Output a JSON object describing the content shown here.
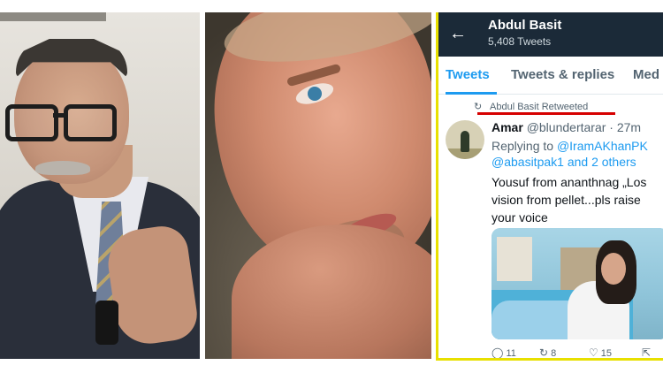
{
  "profile": {
    "name": "Abdul Basit",
    "tweet_count": "5,408 Tweets"
  },
  "tabs": [
    "Tweets",
    "Tweets & replies",
    "Med"
  ],
  "retweet_banner": "Abdul Basit Retweeted",
  "tweet": {
    "author_name": "Amar",
    "author_handle": "@blundertarar",
    "time": "27m",
    "reply_prefix": "Replying to",
    "reply_mention_1": "@IramAKhanPK",
    "reply_line_2_mention": "@abasitpak1",
    "reply_line_2_rest": "and 2 others",
    "text": "Yousuf from ananthnag „Los\nvision from pellet...pls raise\nyour voice"
  },
  "actions": {
    "replies": "11",
    "retweets": "8",
    "likes": "15"
  },
  "icons": {
    "back": "arrow-left-icon",
    "retweet": "retweet-icon",
    "reply": "reply-icon",
    "like": "heart-icon",
    "share": "share-icon"
  },
  "colors": {
    "appbar": "#1b2a38",
    "accent": "#1d9bf0",
    "highlight_border": "#e8e000",
    "annotation_underline": "#d60000"
  }
}
